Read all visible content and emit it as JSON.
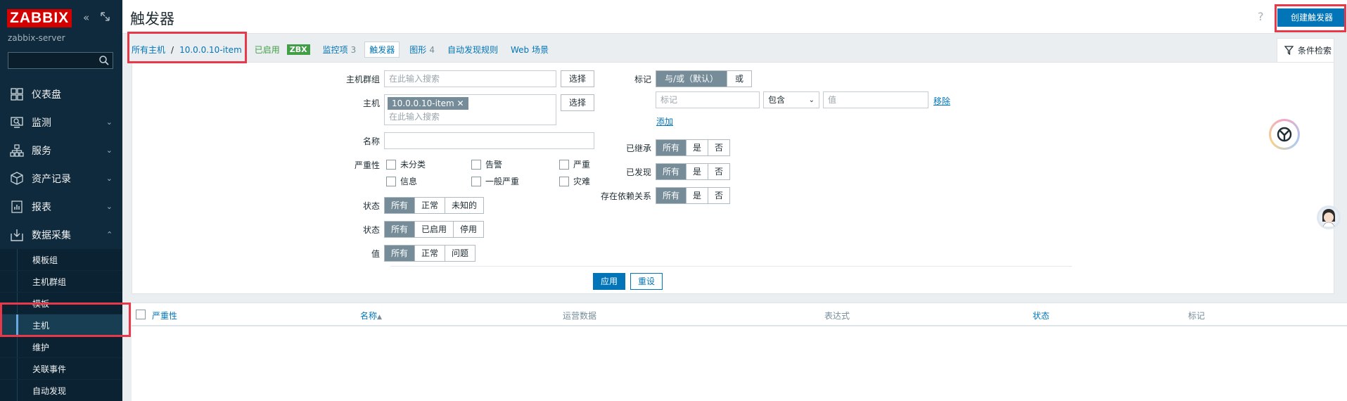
{
  "sidebar": {
    "logo": "ZABBIX",
    "server_name": "zabbix-server",
    "menu": [
      {
        "label": "仪表盘"
      },
      {
        "label": "监测"
      },
      {
        "label": "服务"
      },
      {
        "label": "资产记录"
      },
      {
        "label": "报表"
      },
      {
        "label": "数据采集"
      }
    ],
    "submenu": [
      {
        "label": "模板组"
      },
      {
        "label": "主机群组"
      },
      {
        "label": "模板"
      },
      {
        "label": "主机"
      },
      {
        "label": "维护"
      },
      {
        "label": "关联事件"
      },
      {
        "label": "自动发现"
      }
    ]
  },
  "header": {
    "title": "触发器",
    "help": "?",
    "create_button": "创建触发器"
  },
  "nav": {
    "all_hosts": "所有主机",
    "separator": "/",
    "host": "10.0.0.10-item",
    "enabled": "已启用",
    "zbx": "ZBX",
    "items_label": "监控项",
    "items_count": "3",
    "triggers": "触发器",
    "graphs_label": "图形",
    "graphs_count": "4",
    "discovery": "自动发现规则",
    "web": "Web 场景",
    "filter_tab": "条件检索"
  },
  "filter": {
    "host_groups_label": "主机群组",
    "host_groups_placeholder": "在此输入搜索",
    "select_button": "选择",
    "host_label": "主机",
    "host_chip": "10.0.0.10-item",
    "host_placeholder": "在此输入搜索",
    "name_label": "名称",
    "severity_label": "严重性",
    "severities": [
      "未分类",
      "告警",
      "严重",
      "信息",
      "一般严重",
      "灾难"
    ],
    "state_label": "状态",
    "state_options": [
      "所有",
      "正常",
      "未知的"
    ],
    "status_label": "状态",
    "status_options": [
      "所有",
      "已启用",
      "停用"
    ],
    "value_label": "值",
    "value_options": [
      "所有",
      "正常",
      "问题"
    ],
    "tags_label": "标记",
    "tags_mode": [
      "与/或（默认）",
      "或"
    ],
    "tag_placeholder": "标记",
    "tag_operator": "包含",
    "tag_value_placeholder": "值",
    "remove_link": "移除",
    "add_link": "添加",
    "inherited_label": "已继承",
    "discovered_label": "已发现",
    "dependencies_label": "存在依赖关系",
    "yes_no_options": [
      "所有",
      "是",
      "否"
    ],
    "apply_button": "应用",
    "reset_button": "重设"
  },
  "table": {
    "columns": [
      "严重性",
      "名称",
      "运营数据",
      "表达式",
      "状态",
      "标记"
    ],
    "sort_indicator": "▲"
  },
  "colors": {
    "sidebar_bg": "#0e2a3c",
    "accent": "#0275b8",
    "enabled_green": "#429e47",
    "logo_red": "#d40000",
    "highlight_red": "#e8394a"
  }
}
